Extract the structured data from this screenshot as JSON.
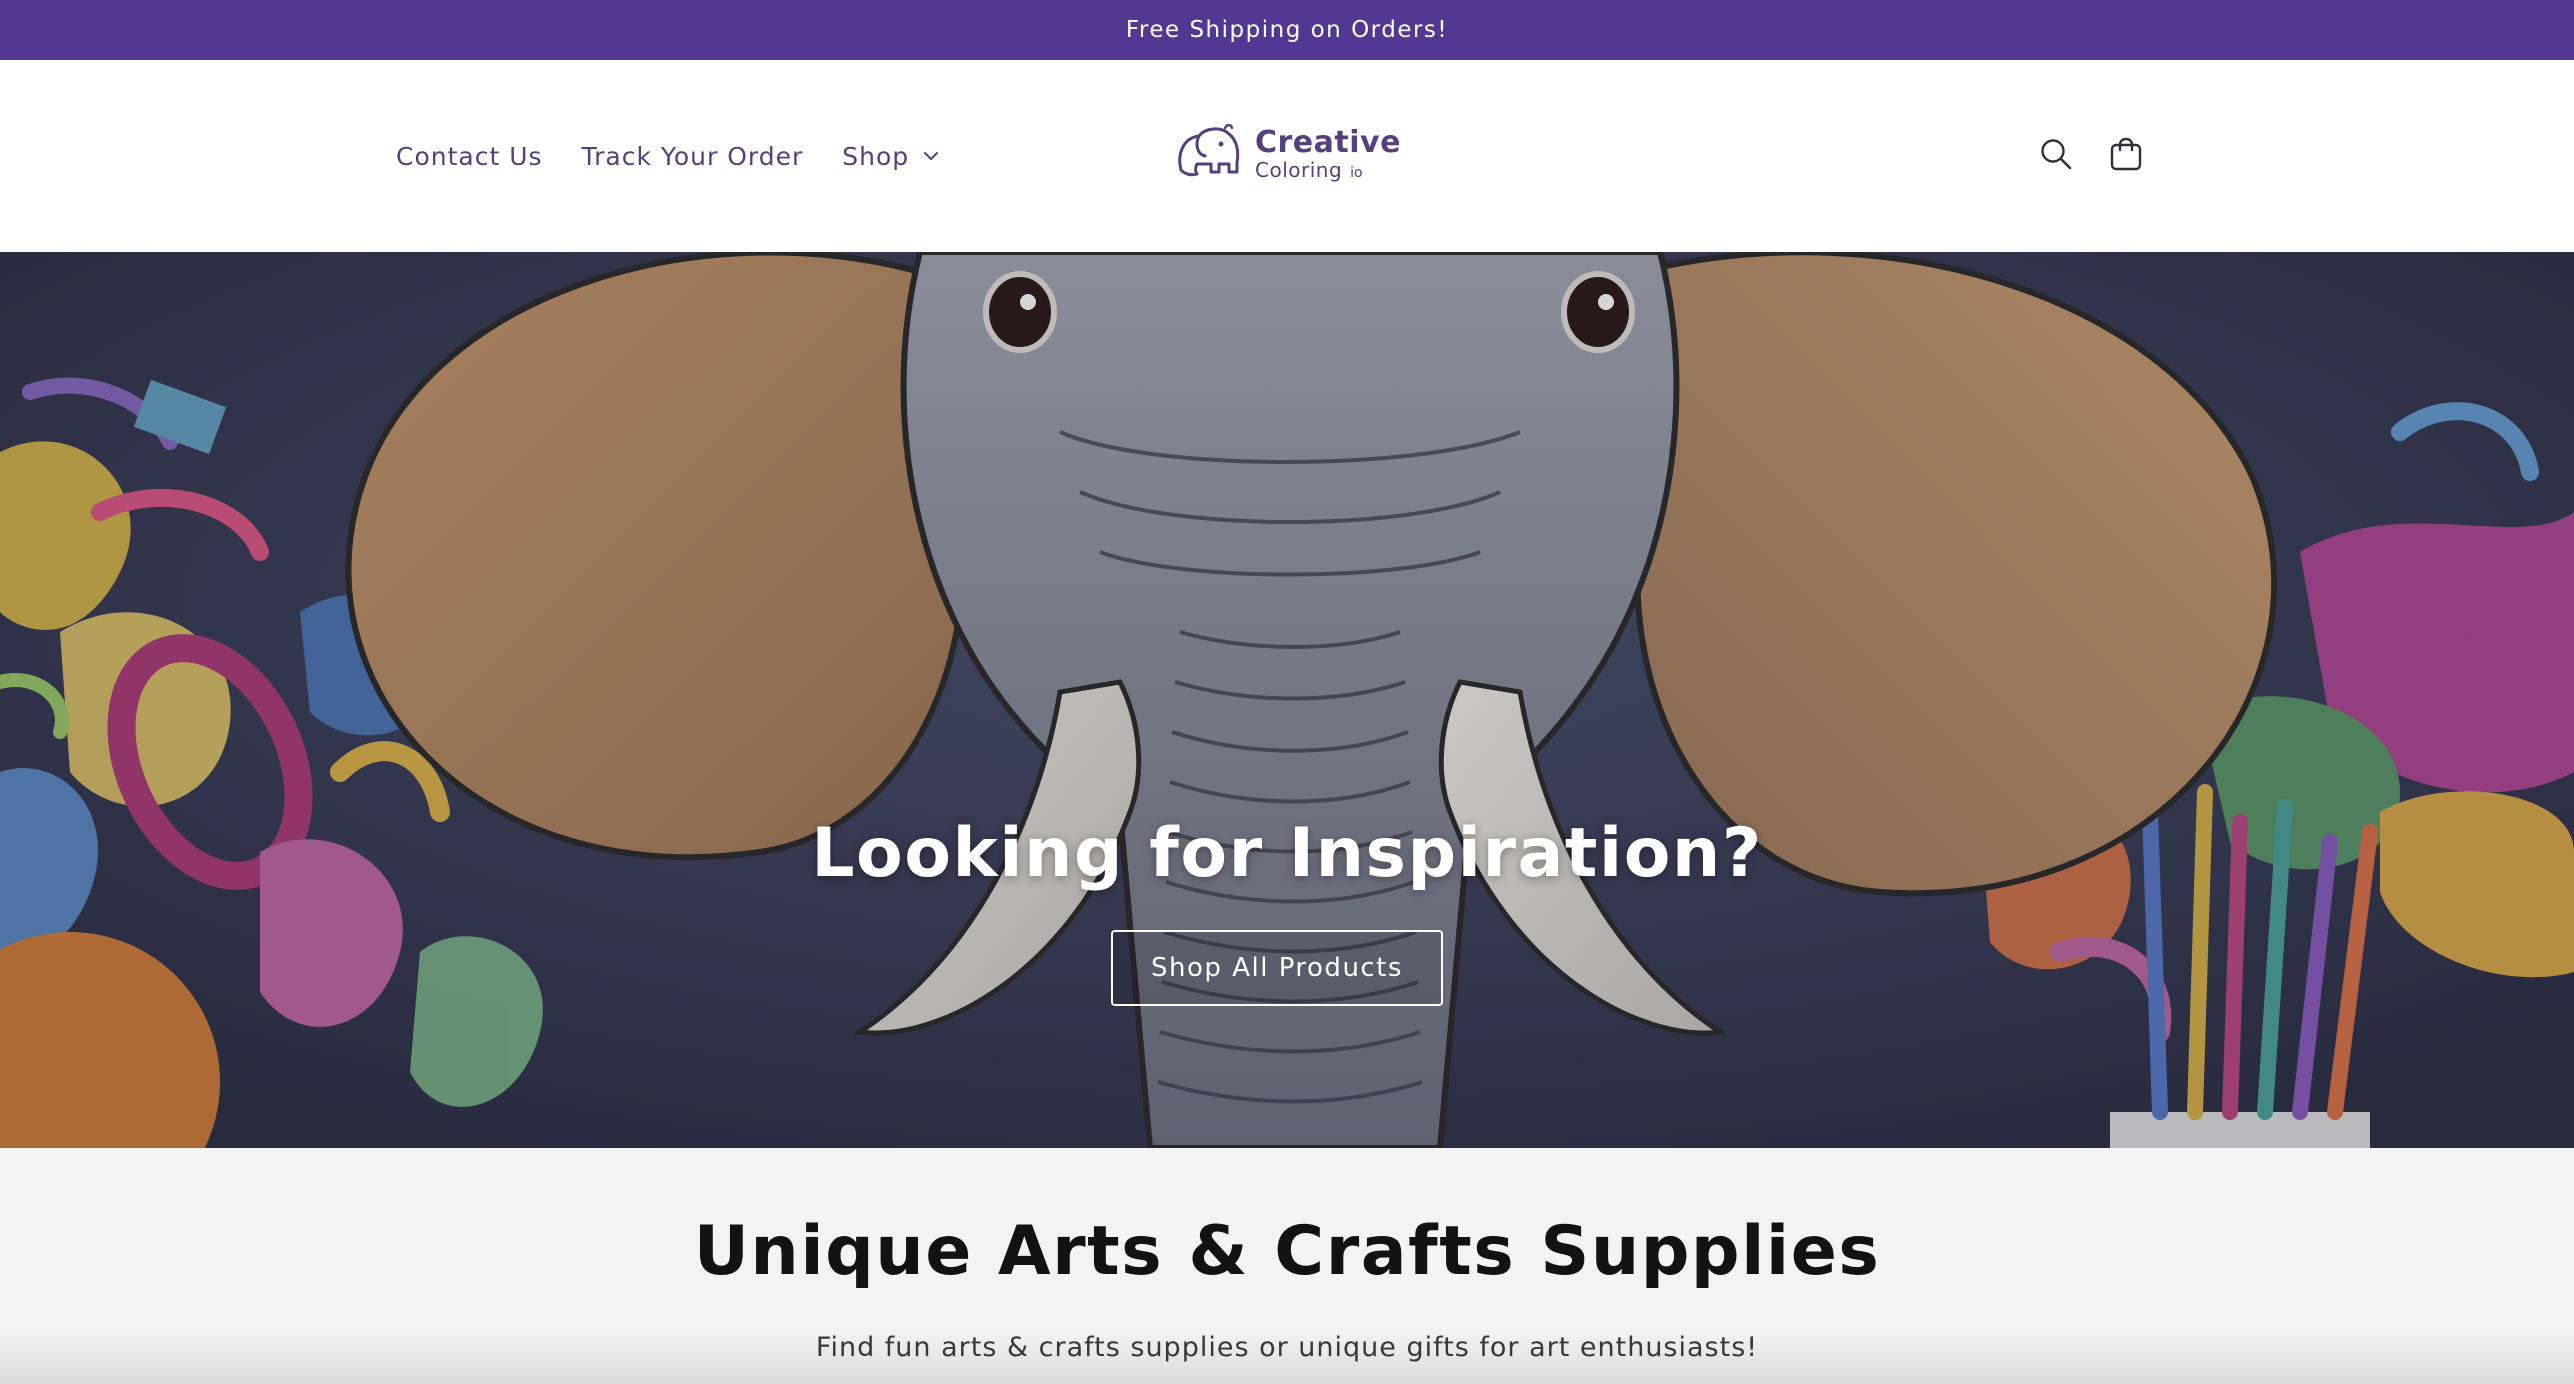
{
  "announcement": {
    "text": "Free Shipping on Orders!"
  },
  "nav": {
    "items": [
      {
        "label": "Contact Us"
      },
      {
        "label": "Track Your Order"
      },
      {
        "label": "Shop",
        "icon": "chevron-down-icon"
      }
    ]
  },
  "logo": {
    "word1": "Creative",
    "word2": "Coloring",
    "suffix": "io",
    "icon": "elephant-logo-icon"
  },
  "header_icons": {
    "search": "search-icon",
    "cart": "cart-icon"
  },
  "hero": {
    "title": "Looking for Inspiration?",
    "button_label": "Shop All Products"
  },
  "intro": {
    "title": "Unique Arts & Crafts Supplies",
    "text": "Find fun arts & crafts supplies or unique gifts for art enthusiasts!"
  },
  "colors": {
    "brand_purple": "#533893",
    "nav_text": "#55407f",
    "intro_bg": "#f3f3f3"
  }
}
